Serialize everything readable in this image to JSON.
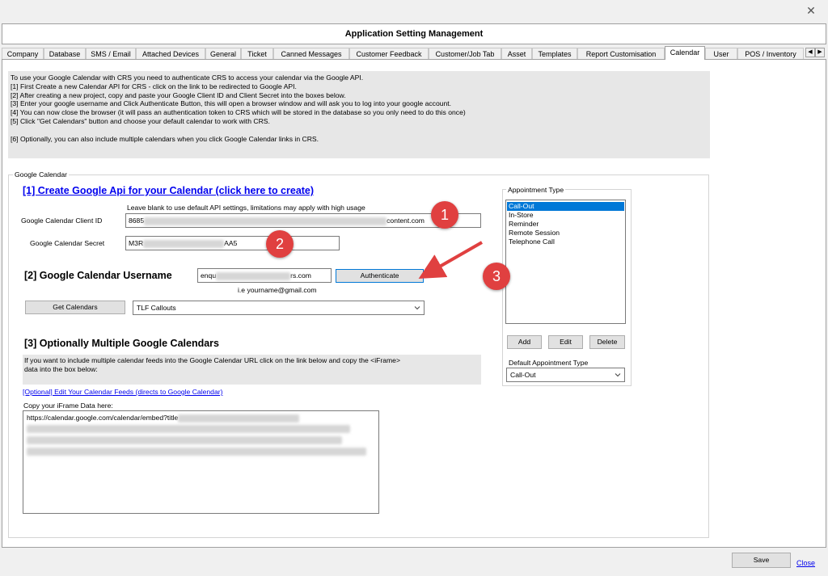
{
  "window": {
    "close_glyph": "✕",
    "title": "Application Setting Management"
  },
  "tabs": [
    "Company",
    "Database",
    "SMS / Email",
    "Attached Devices",
    "General",
    "Ticket",
    "Canned Messages",
    "Customer Feedback",
    "Customer/Job Tab",
    "Asset",
    "Templates",
    "Report Customisation",
    "Calendar",
    "User",
    "POS / Inventory"
  ],
  "active_tab": "Calendar",
  "instructions": [
    "To use your Google Calendar with CRS you need to authenticate CRS to access your calendar via the Google API.",
    "[1] First Create a new Calendar API for CRS - click on the link to be redirected to Google API.",
    "[2] After creating a new project, copy and paste your Google Client ID and Client Secret into the boxes below.",
    "[3] Enter your google username and Click Authenticate Button, this will open a browser window and will ask you to log into your google account.",
    "[4] You can now close the browser (it will pass an authentication token to CRS which will be stored in the database so you only need to do this once)",
    "[5] Click \"Get Calendars\" button and choose your default calendar to work with CRS.",
    "",
    "[6] Optionally, you can also include multiple calendars when you click Google Calendar links in CRS."
  ],
  "google_calendar": {
    "group_label": "Google Calendar",
    "create_api_link": "[1] Create Google Api for your Calendar (click here to create)",
    "blank_hint": "Leave blank to use default  API settings, limitations may apply with high usage",
    "client_id_label": "Google Calendar Client ID",
    "client_id_prefix": "8685",
    "client_id_suffix": "content.com",
    "secret_label": "Google Calendar Secret",
    "secret_prefix": "M3R",
    "secret_suffix": "AA5",
    "username_heading": "[2] Google Calendar Username",
    "username_prefix": "enqu",
    "username_suffix": "rs.com",
    "authenticate_label": "Authenticate",
    "username_hint": "i.e yourname@gmail.com",
    "get_calendars_label": "Get Calendars",
    "calendar_selected": "TLF Callouts",
    "multi_heading": "[3] Optionally Multiple Google Calendars",
    "multi_info_1": "If you want to include multiple calendar feeds into the Google Calendar URL click on the link below and copy the <iFrame>",
    "multi_info_2": "data into the box below:",
    "edit_feeds_link": "[Optional] Edit Your Calendar Feeds (directs to Google Calendar)",
    "iframe_label": "Copy your iFrame Data here:",
    "iframe_prefix": "https://calendar.google.com/calendar/embed?title"
  },
  "appointment_type": {
    "group_label": "Appointment Type",
    "items": [
      "Call-Out",
      "In-Store",
      "Reminder",
      "Remote Session",
      "Telephone Call"
    ],
    "selected_index": 0,
    "add_label": "Add",
    "edit_label": "Edit",
    "delete_label": "Delete",
    "default_label": "Default Appointment Type",
    "default_value": "Call-Out"
  },
  "footer": {
    "save_label": "Save",
    "close_label": "Close"
  },
  "annotations": {
    "badge_1": "1",
    "badge_2": "2",
    "badge_3": "3",
    "badge_color": "#e04040"
  }
}
